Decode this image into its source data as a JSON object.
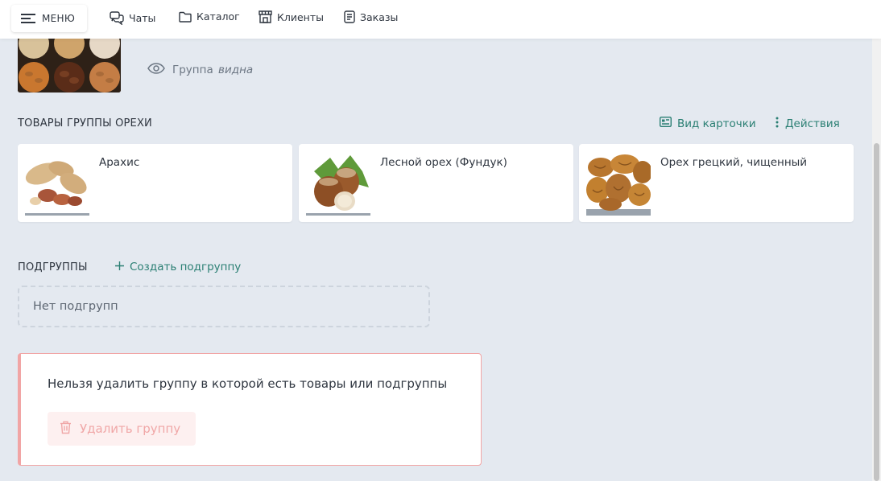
{
  "topbar": {
    "menu_label": "МЕНЮ",
    "nav": [
      {
        "label": "Чаты",
        "icon": "chat-icon"
      },
      {
        "label": "Каталог",
        "icon": "folder-icon"
      },
      {
        "label": "Клиенты",
        "icon": "store-icon"
      },
      {
        "label": "Заказы",
        "icon": "document-icon"
      }
    ]
  },
  "group": {
    "visibility_label": "Группа",
    "visibility_value": "видна"
  },
  "products": {
    "title": "ТОВАРЫ ГРУППЫ ОРЕХИ",
    "card_view_label": "Вид карточки",
    "actions_label": "Действия",
    "items": [
      {
        "name": "Арахис"
      },
      {
        "name": "Лесной орех (Фундук)"
      },
      {
        "name": "Орех грецкий, чищенный"
      }
    ]
  },
  "subgroups": {
    "title": "ПОДГРУППЫ",
    "create_label": "Создать подгруппу",
    "empty_text": "Нет подгрупп"
  },
  "delete": {
    "message": "Нельзя удалить группу в которой есть товары или подгруппы",
    "button_label": "Удалить группу"
  },
  "colors": {
    "accent": "#2a7f73",
    "background": "#e4e9f0",
    "danger_border": "#f1a5a5",
    "danger_text": "#f0a7a7"
  }
}
